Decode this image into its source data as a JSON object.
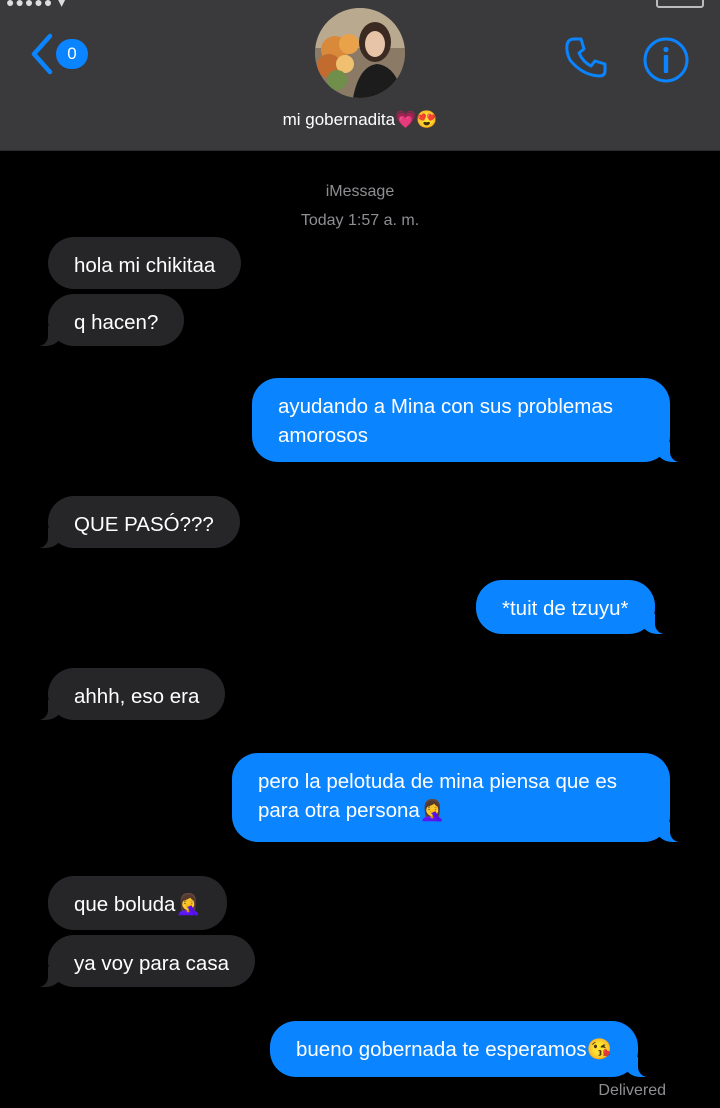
{
  "header": {
    "back_count": "0",
    "contact_name": "mi gobernadita💗😍",
    "accent": "#0a84ff",
    "icons": {
      "back": "chevron-left-icon",
      "call": "phone-icon",
      "info": "info-icon"
    }
  },
  "conversation": {
    "service": "iMessage",
    "timestamp": "Today 1:57 a. m.",
    "messages": [
      {
        "dir": "in",
        "text": "hola mi chikitaa"
      },
      {
        "dir": "in",
        "text": "q hacen?"
      },
      {
        "dir": "out",
        "text": "ayudando a Mina con sus problemas amorosos"
      },
      {
        "dir": "in",
        "text": "QUE PASÓ???"
      },
      {
        "dir": "out",
        "text": "*tuit de tzuyu*"
      },
      {
        "dir": "in",
        "text": "ahhh, eso era"
      },
      {
        "dir": "out",
        "text": "pero la pelotuda de mina piensa que es para otra persona🤦‍♀️"
      },
      {
        "dir": "in",
        "text": "que boluda🤦‍♀️"
      },
      {
        "dir": "in",
        "text": "ya voy para casa"
      },
      {
        "dir": "out",
        "text": "bueno gobernada te esperamos😘"
      }
    ],
    "delivery_status": "Delivered"
  },
  "colors": {
    "incoming_bubble": "#262628",
    "outgoing_bubble": "#0a84ff",
    "header_bg": "#3a3a3c"
  }
}
